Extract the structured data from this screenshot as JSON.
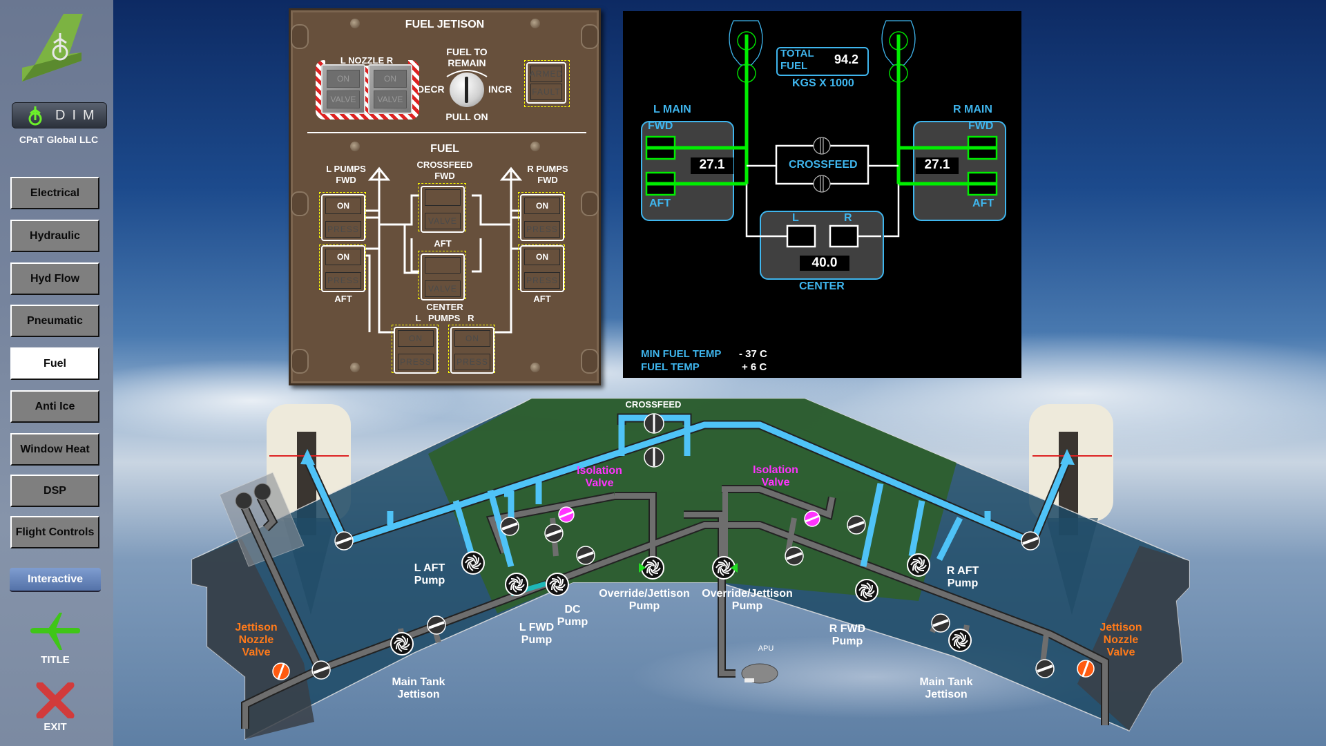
{
  "sidebar": {
    "logo": "dim-tail-logo",
    "dim_label": "DIM",
    "company": "CPaT Global LLC",
    "nav": [
      {
        "label": "Electrical",
        "active": false
      },
      {
        "label": "Hydraulic",
        "active": false
      },
      {
        "label": "Hyd Flow",
        "active": false
      },
      {
        "label": "Pneumatic",
        "active": false
      },
      {
        "label": "Fuel",
        "active": true
      },
      {
        "label": "Anti Ice",
        "active": false
      },
      {
        "label": "Window Heat",
        "active": false
      },
      {
        "label": "DSP",
        "active": false
      },
      {
        "label": "Flight Controls",
        "active": false
      }
    ],
    "mode_button": "Interactive",
    "title_button": "TITLE",
    "exit_button": "EXIT"
  },
  "fuel_panel": {
    "jettison_title": "FUEL JETISON",
    "nozzle_label": "L  NOZZLE  R",
    "nozzle_switches": [
      {
        "side": "L",
        "top": "ON",
        "bottom": "VALVE"
      },
      {
        "side": "R",
        "top": "ON",
        "bottom": "VALVE"
      }
    ],
    "fuel_to_remain": "FUEL TO REMAIN",
    "fuel_to_remain_l1": "FUEL TO",
    "fuel_to_remain_l2": "REMAIN",
    "decr": "DECR",
    "incr": "INCR",
    "pull_on": "PULL ON",
    "arm_switch": {
      "top": "ARMED",
      "bottom": "FAULT"
    },
    "fuel_title": "FUEL",
    "l_pumps_l1": "L PUMPS",
    "l_pumps_l2": "FWD",
    "r_pumps_l1": "R PUMPS",
    "r_pumps_l2": "FWD",
    "aft": "AFT",
    "crossfeed_l1": "CROSSFEED",
    "crossfeed_l2": "FWD",
    "crossfeed_aft": "AFT",
    "center": "CENTER",
    "center_pumps": "L   PUMPS   R",
    "l_fwd_pump": {
      "top": "ON",
      "bottom": "PRESS"
    },
    "l_aft_pump": {
      "top": "ON",
      "bottom": "PRESS"
    },
    "r_fwd_pump": {
      "top": "ON",
      "bottom": "PRESS"
    },
    "r_aft_pump": {
      "top": "ON",
      "bottom": "PRESS"
    },
    "xfeed_fwd": {
      "top": "",
      "bottom": "VALVE"
    },
    "xfeed_aft": {
      "top": "",
      "bottom": "VALVE"
    },
    "ctr_l_pump": {
      "top": "ON",
      "bottom": "PRESS"
    },
    "ctr_r_pump": {
      "top": "ON",
      "bottom": "PRESS"
    }
  },
  "synoptic": {
    "total_fuel_l1": "TOTAL",
    "total_fuel_l2": "FUEL",
    "total_fuel": "94.2",
    "units": "KGS X 1000",
    "l_main": "L MAIN",
    "r_main": "R MAIN",
    "fwd": "FWD",
    "aft": "AFT",
    "l_main_qty": "27.1",
    "r_main_qty": "27.1",
    "crossfeed": "CROSSFEED",
    "center_l": "L",
    "center_r": "R",
    "center_qty": "40.0",
    "center": "CENTER",
    "min_fuel_temp_label": "MIN FUEL TEMP",
    "min_fuel_temp": "- 37 C",
    "fuel_temp_label": "FUEL TEMP",
    "fuel_temp": "+ 6 C",
    "colors": {
      "label": "#3fb6ee",
      "flow": "#00ee00",
      "line": "#ffffff"
    }
  },
  "schematic": {
    "crossfeed": "CROSSFEED",
    "isolation_l1": "Isolation",
    "isolation_l2": "Valve",
    "l_aft_pump_l1": "L AFT",
    "r_aft_pump_l1": "R AFT",
    "pump": "Pump",
    "l_fwd_pump_l1": "L FWD",
    "r_fwd_pump_l1": "R FWD",
    "dc_pump_l1": "DC",
    "override_l1": "Override/Jettison",
    "main_tank_l1": "Main Tank",
    "main_tank_l2": "Jettison",
    "jettison_l1": "Jettison",
    "jettison_l2": "Nozzle",
    "jettison_l3": "Valve",
    "apu": "APU",
    "colors": {
      "feed": "#4fc3f7",
      "pipe": "#6e6e6e",
      "isolation": "#ff33ff",
      "jettison": "#ff7a1a",
      "center_tank": "#2e5f2e",
      "main_tank": "#1d4a66"
    }
  }
}
